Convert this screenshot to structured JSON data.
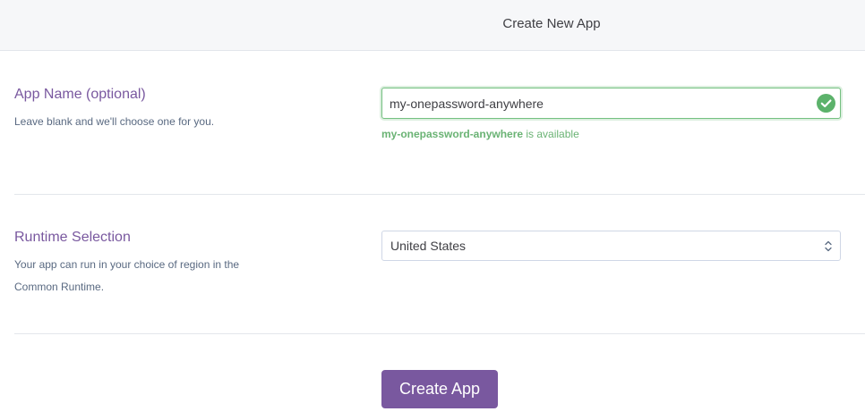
{
  "header": {
    "title": "Create New App"
  },
  "app_name": {
    "title": "App Name (optional)",
    "description": "Leave blank and we'll choose one for you.",
    "value": "my-onepassword-anywhere",
    "available_name": "my-onepassword-anywhere",
    "available_suffix": " is available"
  },
  "runtime": {
    "title": "Runtime Selection",
    "description": "Your app can run in your choice of region in the Common Runtime.",
    "selected": "United States"
  },
  "actions": {
    "create_label": "Create App"
  },
  "colors": {
    "accent": "#79589f",
    "success": "#74c080"
  }
}
